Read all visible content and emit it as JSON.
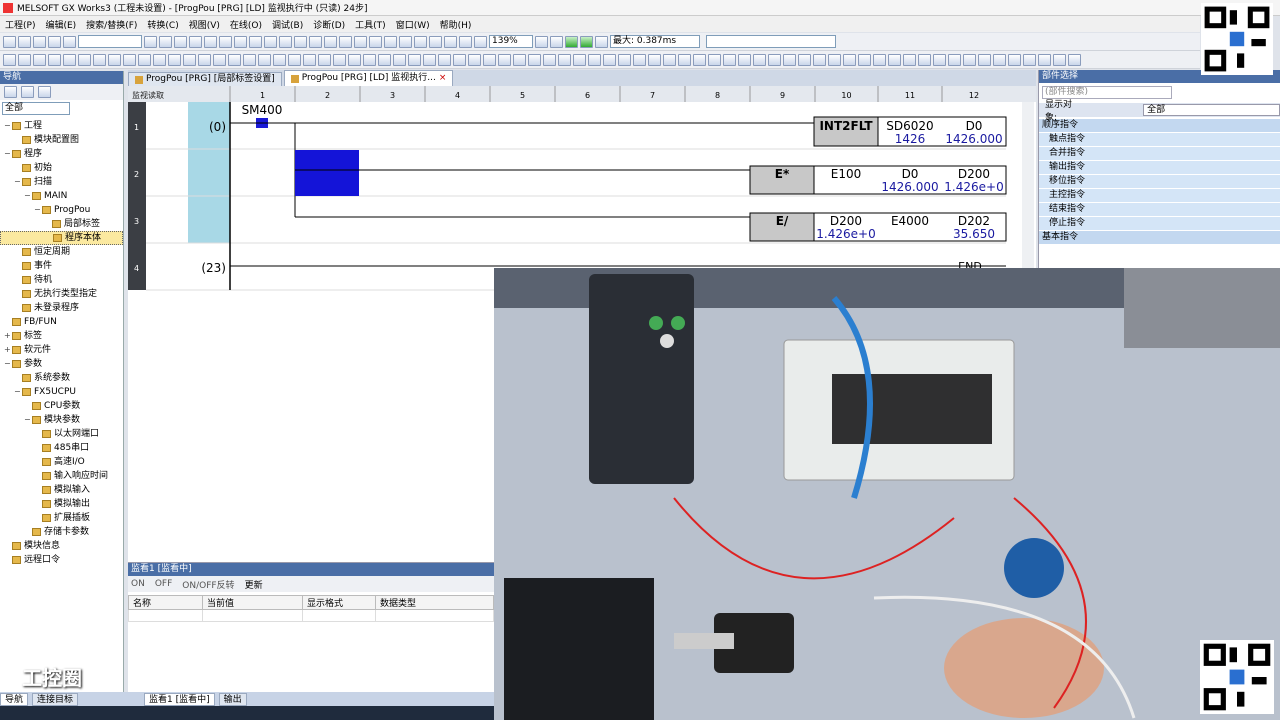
{
  "window": {
    "title": "MELSOFT GX Works3 (工程未设置) - [ProgPou [PRG] [LD] 监视执行中 (只读) 24步]"
  },
  "menu": [
    "工程(P)",
    "编辑(E)",
    "搜索/替换(F)",
    "转换(C)",
    "视图(V)",
    "在线(O)",
    "调试(B)",
    "诊断(D)",
    "工具(T)",
    "窗口(W)",
    "帮助(H)"
  ],
  "toolbar": {
    "zoom": "139%",
    "scan_label": "最大: 0.387ms"
  },
  "nav": {
    "title": "导航",
    "filter": "全部",
    "items": [
      {
        "label": "工程",
        "depth": 0,
        "exp": "−"
      },
      {
        "label": "模块配置图",
        "depth": 1,
        "exp": ""
      },
      {
        "label": "程序",
        "depth": 0,
        "exp": "−"
      },
      {
        "label": "初始",
        "depth": 1,
        "exp": ""
      },
      {
        "label": "扫描",
        "depth": 1,
        "exp": "−"
      },
      {
        "label": "MAIN",
        "depth": 2,
        "exp": "−"
      },
      {
        "label": "ProgPou",
        "depth": 3,
        "exp": "−"
      },
      {
        "label": "局部标签",
        "depth": 4,
        "exp": ""
      },
      {
        "label": "程序本体",
        "depth": 4,
        "exp": "",
        "hl": true
      },
      {
        "label": "恒定周期",
        "depth": 1,
        "exp": ""
      },
      {
        "label": "事件",
        "depth": 1,
        "exp": ""
      },
      {
        "label": "待机",
        "depth": 1,
        "exp": ""
      },
      {
        "label": "无执行类型指定",
        "depth": 1,
        "exp": ""
      },
      {
        "label": "未登录程序",
        "depth": 1,
        "exp": ""
      },
      {
        "label": "FB/FUN",
        "depth": 0,
        "exp": ""
      },
      {
        "label": "标签",
        "depth": 0,
        "exp": "+"
      },
      {
        "label": "软元件",
        "depth": 0,
        "exp": "+"
      },
      {
        "label": "参数",
        "depth": 0,
        "exp": "−"
      },
      {
        "label": "系统参数",
        "depth": 1,
        "exp": ""
      },
      {
        "label": "FX5UCPU",
        "depth": 1,
        "exp": "−"
      },
      {
        "label": "CPU参数",
        "depth": 2,
        "exp": ""
      },
      {
        "label": "模块参数",
        "depth": 2,
        "exp": "−"
      },
      {
        "label": "以太网端口",
        "depth": 3,
        "exp": ""
      },
      {
        "label": "485串口",
        "depth": 3,
        "exp": ""
      },
      {
        "label": "高速I/O",
        "depth": 3,
        "exp": ""
      },
      {
        "label": "输入响应时间",
        "depth": 3,
        "exp": ""
      },
      {
        "label": "模拟输入",
        "depth": 3,
        "exp": ""
      },
      {
        "label": "模拟输出",
        "depth": 3,
        "exp": ""
      },
      {
        "label": "扩展插板",
        "depth": 3,
        "exp": ""
      },
      {
        "label": "存储卡参数",
        "depth": 2,
        "exp": ""
      },
      {
        "label": "模块信息",
        "depth": 0,
        "exp": ""
      },
      {
        "label": "远程口令",
        "depth": 0,
        "exp": ""
      }
    ]
  },
  "tabs": [
    {
      "label": "ProgPou [PRG] [局部标签设置]"
    },
    {
      "label": "ProgPou [PRG] [LD] 监视执行...",
      "close": "×"
    }
  ],
  "ladder": {
    "corner": "监视读取",
    "columns": [
      "1",
      "2",
      "3",
      "4",
      "5",
      "6",
      "7",
      "8",
      "9",
      "10",
      "11",
      "12"
    ],
    "rows": [
      "1",
      "2",
      "3",
      "4"
    ],
    "step0": "(0)",
    "step23": "(23)",
    "contact": "SM400",
    "end": "END",
    "r1": {
      "instr": "INT2FLT",
      "op1": "SD6020",
      "op1v": "1426",
      "op2": "D0",
      "op2v": "1426.000"
    },
    "r2": {
      "instr": "E*",
      "op1": "E100",
      "op2": "D0",
      "op2v": "1426.000",
      "op3": "D200",
      "op3v": "1.426e+0"
    },
    "r3": {
      "instr": "E/",
      "op1": "D200",
      "op1v": "1.426e+0",
      "op2": "E4000",
      "op3": "D202",
      "op3v": "35.650"
    }
  },
  "watch": {
    "title": "监看1 [监看中]",
    "toolbar": {
      "on": "ON",
      "off": "OFF",
      "toggle": "ON/OFF反转",
      "update": "更新"
    },
    "columns": [
      "名称",
      "当前值",
      "显示格式",
      "数据类型"
    ]
  },
  "parts": {
    "title": "部件选择",
    "search": "(部件搜索)",
    "display_label": "显示对象:",
    "display_value": "全部",
    "groups": [
      {
        "label": "顺序指令",
        "grp": true
      },
      {
        "label": "触点指令"
      },
      {
        "label": "合并指令"
      },
      {
        "label": "输出指令"
      },
      {
        "label": "移位指令"
      },
      {
        "label": "主控指令"
      },
      {
        "label": "结束指令"
      },
      {
        "label": "停止指令"
      },
      {
        "label": "基本指令",
        "grp": true
      }
    ]
  },
  "statusbar": {
    "nav": "导航",
    "target": "连接目标",
    "watch": "监看1 [监看中]",
    "output": "输出"
  },
  "watermark": "工控圈"
}
